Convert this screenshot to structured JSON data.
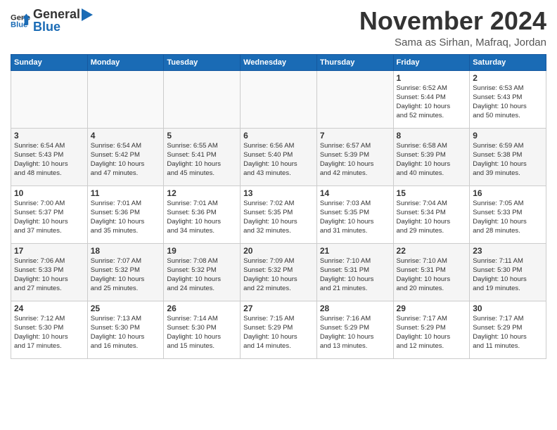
{
  "logo": {
    "general": "General",
    "blue": "Blue"
  },
  "header": {
    "month": "November 2024",
    "location": "Sama as Sirhan, Mafraq, Jordan"
  },
  "weekdays": [
    "Sunday",
    "Monday",
    "Tuesday",
    "Wednesday",
    "Thursday",
    "Friday",
    "Saturday"
  ],
  "weeks": [
    [
      {
        "day": "",
        "info": ""
      },
      {
        "day": "",
        "info": ""
      },
      {
        "day": "",
        "info": ""
      },
      {
        "day": "",
        "info": ""
      },
      {
        "day": "",
        "info": ""
      },
      {
        "day": "1",
        "info": "Sunrise: 6:52 AM\nSunset: 5:44 PM\nDaylight: 10 hours\nand 52 minutes."
      },
      {
        "day": "2",
        "info": "Sunrise: 6:53 AM\nSunset: 5:43 PM\nDaylight: 10 hours\nand 50 minutes."
      }
    ],
    [
      {
        "day": "3",
        "info": "Sunrise: 6:54 AM\nSunset: 5:43 PM\nDaylight: 10 hours\nand 48 minutes."
      },
      {
        "day": "4",
        "info": "Sunrise: 6:54 AM\nSunset: 5:42 PM\nDaylight: 10 hours\nand 47 minutes."
      },
      {
        "day": "5",
        "info": "Sunrise: 6:55 AM\nSunset: 5:41 PM\nDaylight: 10 hours\nand 45 minutes."
      },
      {
        "day": "6",
        "info": "Sunrise: 6:56 AM\nSunset: 5:40 PM\nDaylight: 10 hours\nand 43 minutes."
      },
      {
        "day": "7",
        "info": "Sunrise: 6:57 AM\nSunset: 5:39 PM\nDaylight: 10 hours\nand 42 minutes."
      },
      {
        "day": "8",
        "info": "Sunrise: 6:58 AM\nSunset: 5:39 PM\nDaylight: 10 hours\nand 40 minutes."
      },
      {
        "day": "9",
        "info": "Sunrise: 6:59 AM\nSunset: 5:38 PM\nDaylight: 10 hours\nand 39 minutes."
      }
    ],
    [
      {
        "day": "10",
        "info": "Sunrise: 7:00 AM\nSunset: 5:37 PM\nDaylight: 10 hours\nand 37 minutes."
      },
      {
        "day": "11",
        "info": "Sunrise: 7:01 AM\nSunset: 5:36 PM\nDaylight: 10 hours\nand 35 minutes."
      },
      {
        "day": "12",
        "info": "Sunrise: 7:01 AM\nSunset: 5:36 PM\nDaylight: 10 hours\nand 34 minutes."
      },
      {
        "day": "13",
        "info": "Sunrise: 7:02 AM\nSunset: 5:35 PM\nDaylight: 10 hours\nand 32 minutes."
      },
      {
        "day": "14",
        "info": "Sunrise: 7:03 AM\nSunset: 5:35 PM\nDaylight: 10 hours\nand 31 minutes."
      },
      {
        "day": "15",
        "info": "Sunrise: 7:04 AM\nSunset: 5:34 PM\nDaylight: 10 hours\nand 29 minutes."
      },
      {
        "day": "16",
        "info": "Sunrise: 7:05 AM\nSunset: 5:33 PM\nDaylight: 10 hours\nand 28 minutes."
      }
    ],
    [
      {
        "day": "17",
        "info": "Sunrise: 7:06 AM\nSunset: 5:33 PM\nDaylight: 10 hours\nand 27 minutes."
      },
      {
        "day": "18",
        "info": "Sunrise: 7:07 AM\nSunset: 5:32 PM\nDaylight: 10 hours\nand 25 minutes."
      },
      {
        "day": "19",
        "info": "Sunrise: 7:08 AM\nSunset: 5:32 PM\nDaylight: 10 hours\nand 24 minutes."
      },
      {
        "day": "20",
        "info": "Sunrise: 7:09 AM\nSunset: 5:32 PM\nDaylight: 10 hours\nand 22 minutes."
      },
      {
        "day": "21",
        "info": "Sunrise: 7:10 AM\nSunset: 5:31 PM\nDaylight: 10 hours\nand 21 minutes."
      },
      {
        "day": "22",
        "info": "Sunrise: 7:10 AM\nSunset: 5:31 PM\nDaylight: 10 hours\nand 20 minutes."
      },
      {
        "day": "23",
        "info": "Sunrise: 7:11 AM\nSunset: 5:30 PM\nDaylight: 10 hours\nand 19 minutes."
      }
    ],
    [
      {
        "day": "24",
        "info": "Sunrise: 7:12 AM\nSunset: 5:30 PM\nDaylight: 10 hours\nand 17 minutes."
      },
      {
        "day": "25",
        "info": "Sunrise: 7:13 AM\nSunset: 5:30 PM\nDaylight: 10 hours\nand 16 minutes."
      },
      {
        "day": "26",
        "info": "Sunrise: 7:14 AM\nSunset: 5:30 PM\nDaylight: 10 hours\nand 15 minutes."
      },
      {
        "day": "27",
        "info": "Sunrise: 7:15 AM\nSunset: 5:29 PM\nDaylight: 10 hours\nand 14 minutes."
      },
      {
        "day": "28",
        "info": "Sunrise: 7:16 AM\nSunset: 5:29 PM\nDaylight: 10 hours\nand 13 minutes."
      },
      {
        "day": "29",
        "info": "Sunrise: 7:17 AM\nSunset: 5:29 PM\nDaylight: 10 hours\nand 12 minutes."
      },
      {
        "day": "30",
        "info": "Sunrise: 7:17 AM\nSunset: 5:29 PM\nDaylight: 10 hours\nand 11 minutes."
      }
    ]
  ]
}
